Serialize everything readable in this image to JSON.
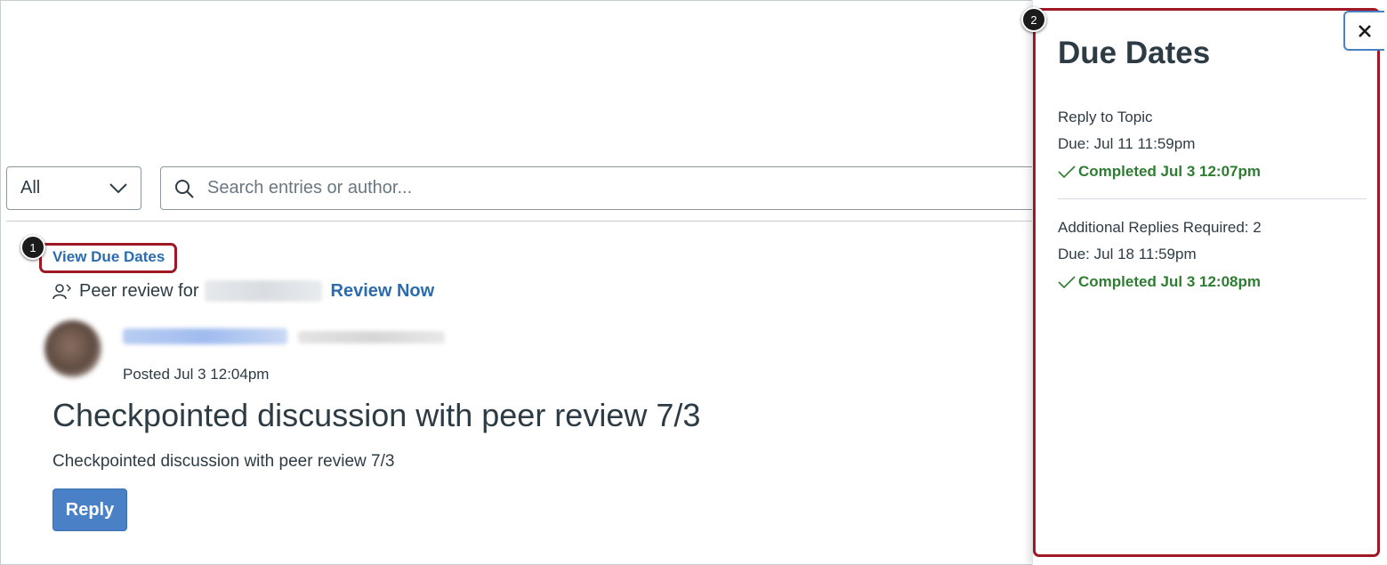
{
  "filter": {
    "selected": "All"
  },
  "search": {
    "placeholder": "Search entries or author..."
  },
  "callouts": {
    "one": "1",
    "two": "2"
  },
  "links": {
    "view_due_dates": "View Due Dates",
    "review_now": "Review Now"
  },
  "peer_review": {
    "prefix": "Peer review for"
  },
  "post": {
    "posted": "Posted Jul 3 12:04pm",
    "title": "Checkpointed discussion with peer review 7/3",
    "body": "Checkpointed discussion with peer review 7/3",
    "reply_label": "Reply"
  },
  "tray": {
    "title": "Due Dates",
    "checkpoints": [
      {
        "label": "Reply to Topic",
        "due": "Due: Jul 11 11:59pm",
        "completed": "Completed Jul 3 12:07pm"
      },
      {
        "label": "Additional Replies Required: 2",
        "due": "Due: Jul 18 11:59pm",
        "completed": "Completed Jul 3 12:08pm"
      }
    ]
  },
  "colors": {
    "link": "#2b6cb0",
    "success": "#2e7d32",
    "callout_border": "#a01825",
    "button": "#4a80c6"
  }
}
